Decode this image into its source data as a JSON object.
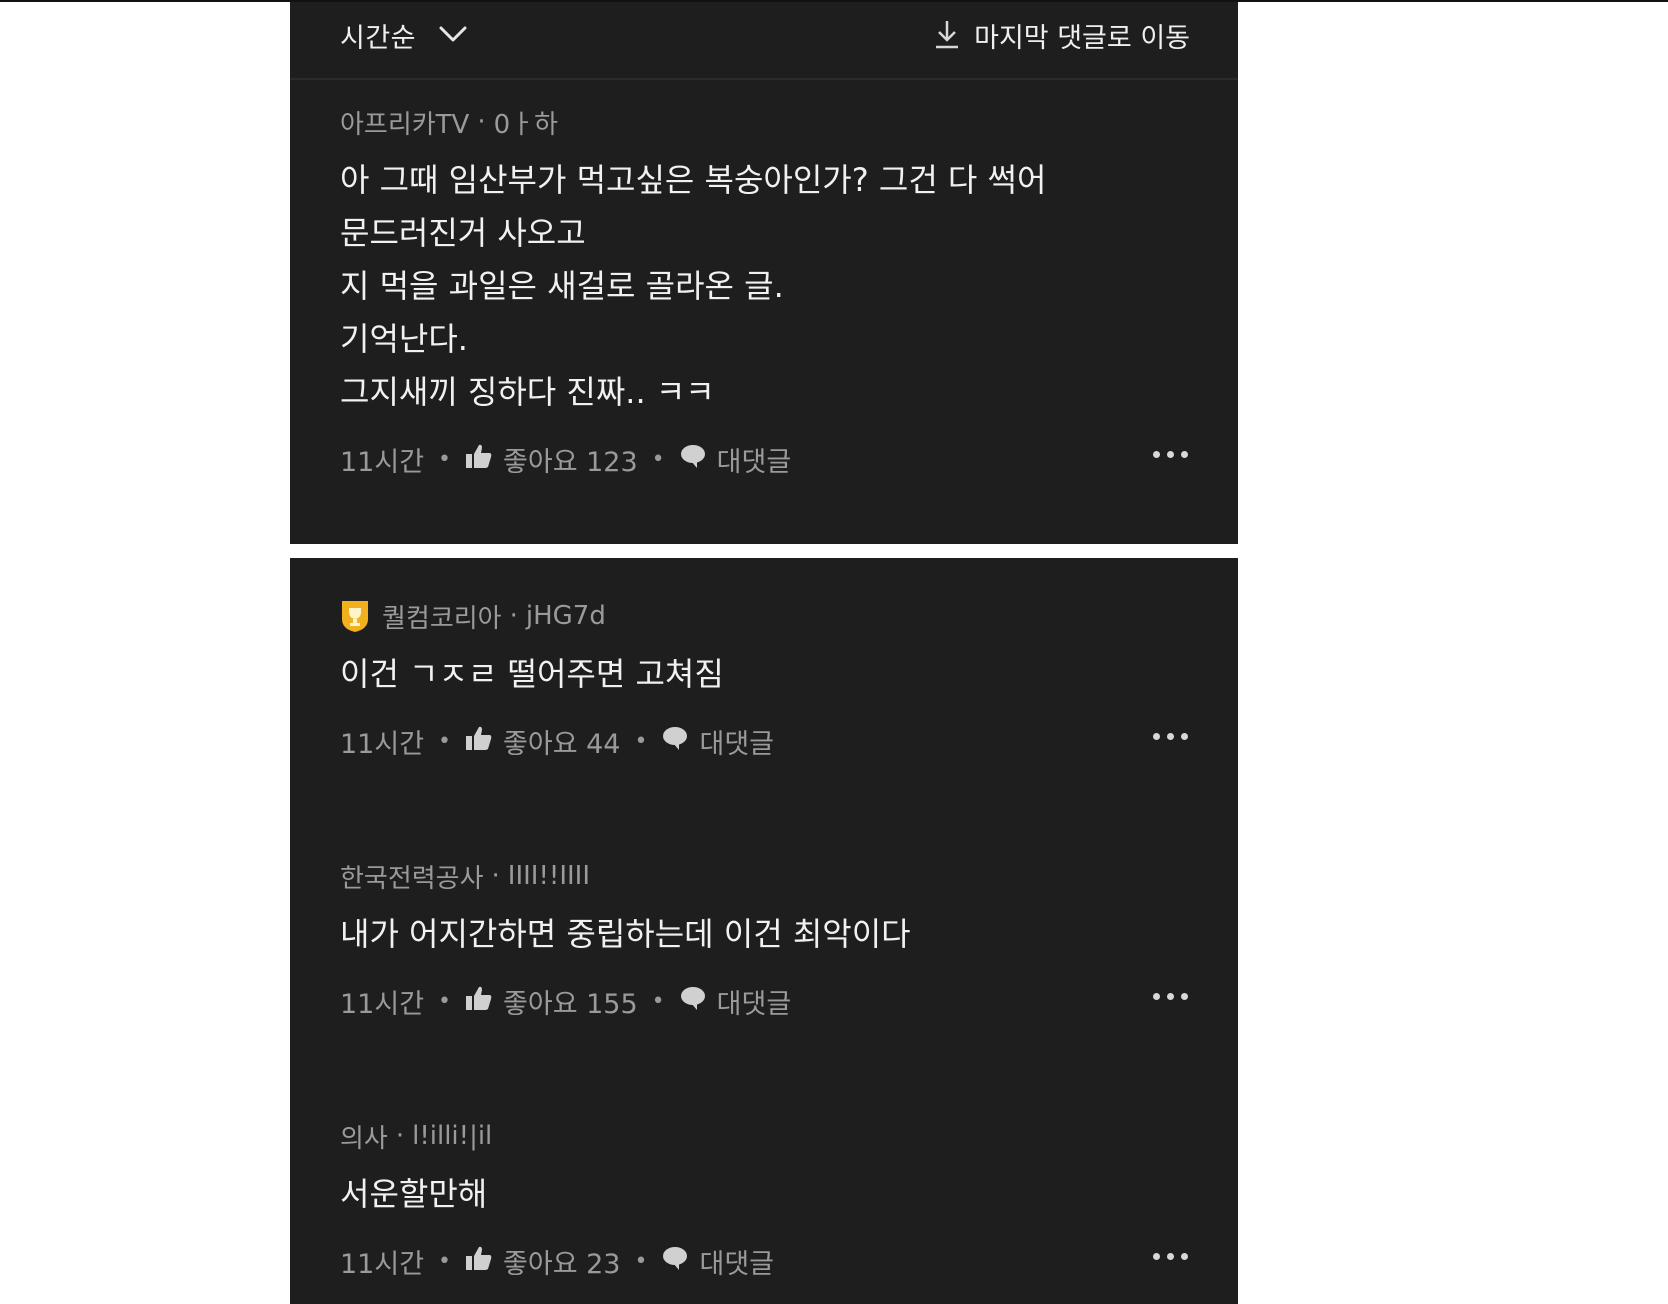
{
  "header": {
    "sort_label": "시간순",
    "jump_label": "마지막 댓글로 이동"
  },
  "comments": [
    {
      "author": "아프리카TV",
      "handle": "0ㅏ하",
      "badge": null,
      "text": "아 그때 임산부가 먹고싶은 복숭아인가? 그건 다 썩어\n문드러진거 사오고\n지 먹을 과일은 새걸로 골라온 글.\n기억난다.\n그지새끼 징하다 진짜..  ㅋㅋ",
      "time": "11시간",
      "likes": "좋아요 123",
      "reply_label": "대댓글"
    },
    {
      "author": "퀄컴코리아",
      "handle": "jHG7d",
      "badge": "trophy-badge",
      "text": "이건 ㄱㅈㄹ 떨어주면 고쳐짐",
      "time": "11시간",
      "likes": "좋아요 44",
      "reply_label": "대댓글"
    },
    {
      "author": "한국전력공사",
      "handle": "IIII!!IIII",
      "badge": null,
      "text": "내가 어지간하면 중립하는데 이건 최악이다",
      "time": "11시간",
      "likes": "좋아요 155",
      "reply_label": "대댓글"
    },
    {
      "author": "의사",
      "handle": "l!illi!|il",
      "badge": null,
      "text": "서운할만해",
      "time": "11시간",
      "likes": "좋아요 23",
      "reply_label": "대댓글"
    }
  ],
  "colors": {
    "panel_bg": "#1e1e1e",
    "text_primary": "#f1f1f1",
    "text_secondary": "#9a9a9a",
    "badge_gold": "#f2b01e"
  }
}
